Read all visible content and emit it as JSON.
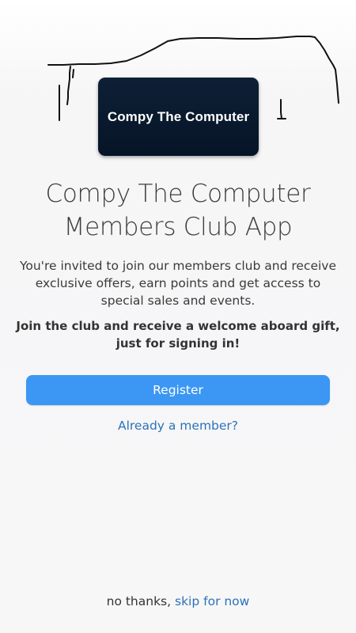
{
  "colors": {
    "accent": "#3b97f3",
    "link": "#2c72b8",
    "logo_background": "#0b1a2e",
    "text": "#333333",
    "background": "#f7f7f8"
  },
  "logo": {
    "text": "Compy The Computer"
  },
  "title": {
    "line1": "Compy The Computer",
    "line2": "Members Club App"
  },
  "intro": {
    "line1": "You're invited to join our members club and receive",
    "line2": "exclusive offers, earn points and get access to",
    "line3": "special sales and events."
  },
  "promo": {
    "line1": "Join the club and receive a welcome aboard gift,",
    "line2": "just for signing in!"
  },
  "actions": {
    "register_label": "Register",
    "member_link": "Already a member?"
  },
  "footer": {
    "prefix": "no thanks,",
    "skip_label": "skip for now"
  }
}
